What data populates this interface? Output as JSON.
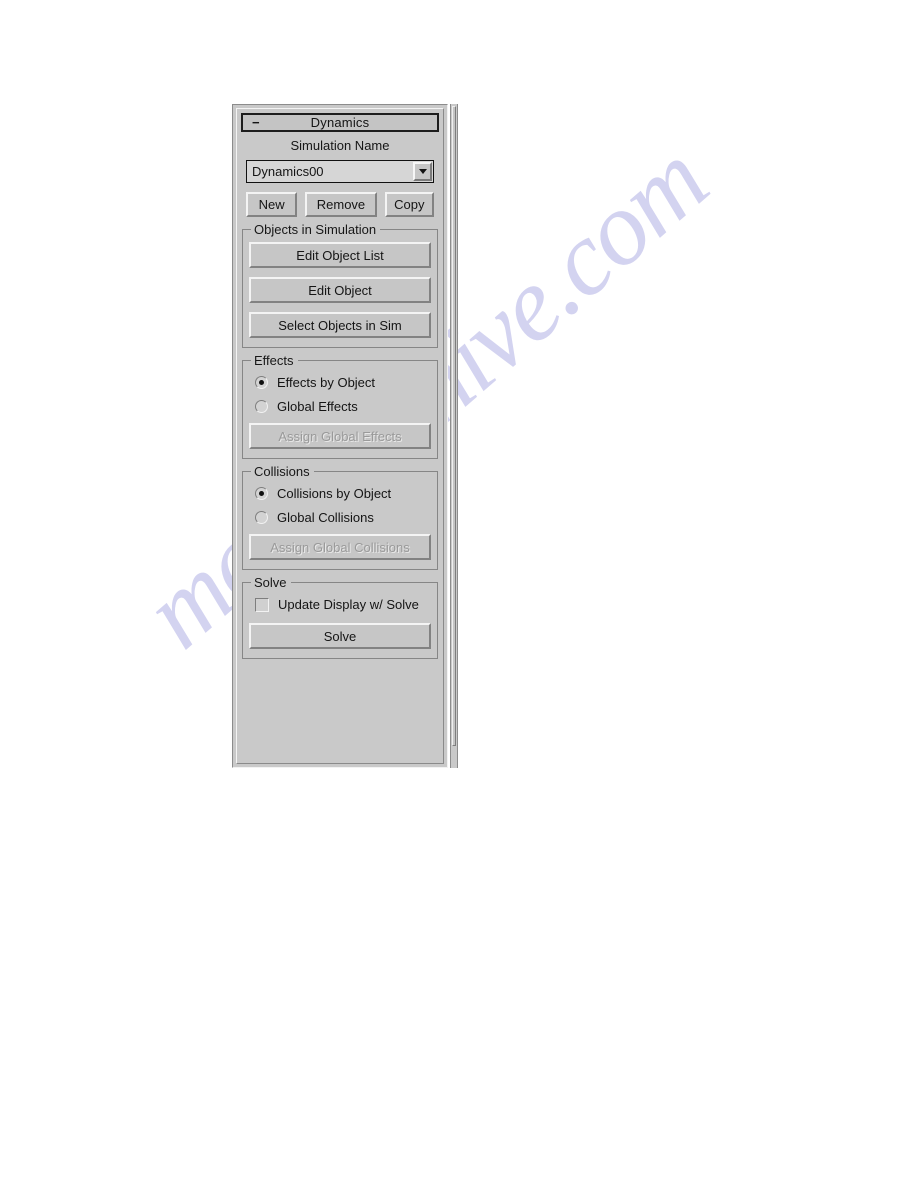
{
  "panel": {
    "rollout": {
      "collapse_icon": "minus-icon",
      "title": "Dynamics"
    },
    "simulation_name_label": "Simulation Name",
    "simulation_name_combo": {
      "value": "Dynamics00",
      "arrow_icon": "chevron-down-icon"
    },
    "action_buttons": [
      {
        "label": "New"
      },
      {
        "label": "Remove"
      },
      {
        "label": "Copy"
      }
    ],
    "groups": {
      "objects_in_simulation": {
        "label": "Objects in Simulation",
        "buttons": [
          {
            "label": "Edit Object List"
          },
          {
            "label": "Edit Object"
          },
          {
            "label": "Select Objects in Sim"
          }
        ]
      },
      "effects": {
        "label": "Effects",
        "radios": [
          {
            "label": "Effects by Object",
            "checked": true
          },
          {
            "label": "Global Effects",
            "checked": false
          }
        ],
        "button": {
          "label": "Assign Global Effects",
          "disabled": true
        }
      },
      "collisions": {
        "label": "Collisions",
        "radios": [
          {
            "label": "Collisions by Object",
            "checked": true
          },
          {
            "label": "Global Collisions",
            "checked": false
          }
        ],
        "button": {
          "label": "Assign Global Collisions",
          "disabled": true
        }
      },
      "solve": {
        "label": "Solve",
        "checkbox": {
          "label": "Update Display w/ Solve",
          "checked": false
        },
        "button": {
          "label": "Solve"
        }
      }
    }
  },
  "watermark": {
    "text": "manualshive.com",
    "color": "#b9b9e8"
  }
}
